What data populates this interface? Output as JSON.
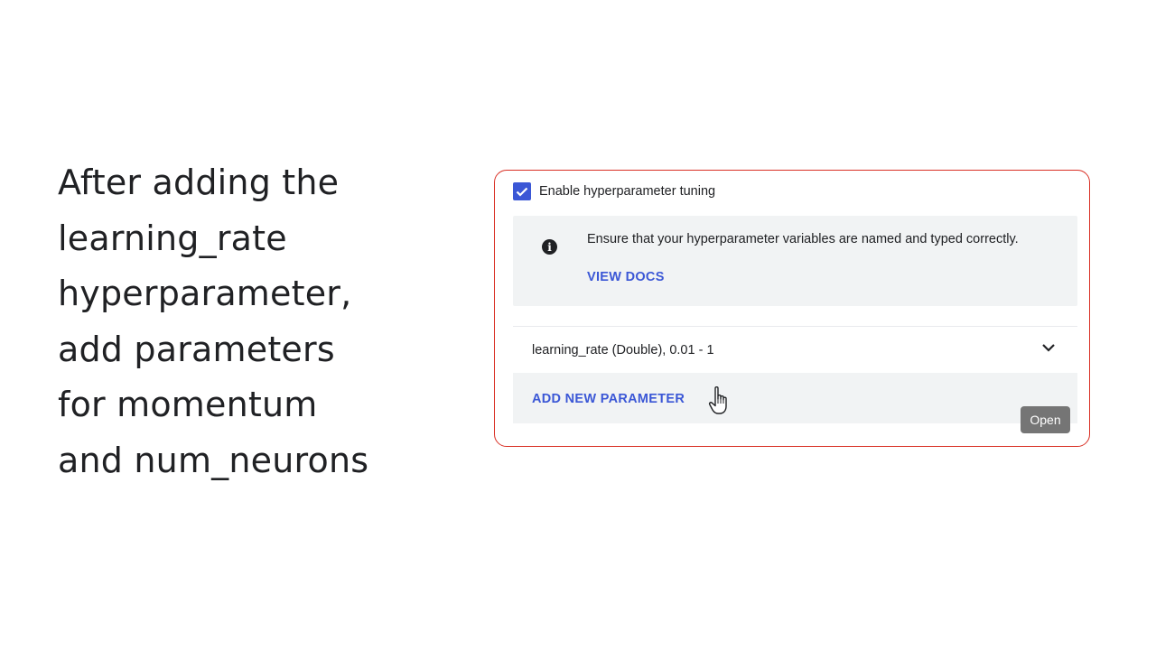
{
  "caption": {
    "lines": [
      "After adding the",
      "learning_rate",
      "hyperparameter,",
      "add parameters",
      "for momentum",
      "and num_neurons"
    ]
  },
  "panel": {
    "enable_checkbox": {
      "label": "Enable hyperparameter tuning",
      "checked": true
    },
    "info": {
      "icon": "info-icon",
      "message": "Ensure that your hyperparameter variables are named and typed correctly.",
      "link_label": "VIEW DOCS"
    },
    "parameters": [
      {
        "label": "learning_rate (Double), 0.01 - 1",
        "icon": "chevron-down-icon"
      }
    ],
    "add_button_label": "ADD NEW PARAMETER",
    "open_badge_label": "Open"
  },
  "colors": {
    "accent": "#3b57d6",
    "highlight_border": "#d93025",
    "info_bg": "#f1f3f4",
    "badge_bg": "#757575"
  }
}
